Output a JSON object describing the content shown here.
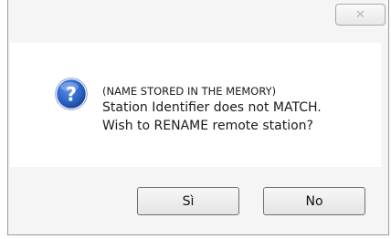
{
  "titlebar": {
    "close_glyph": "✕"
  },
  "dialog": {
    "icon": "question-icon",
    "line1": "(NAME STORED IN THE MEMORY)",
    "line2": "Station Identifier does not MATCH.",
    "line3": "Wish to RENAME remote station?"
  },
  "buttons": {
    "yes_label": "Sì",
    "no_label": "No"
  },
  "colors": {
    "icon_blue": "#2a64c8",
    "content_bg": "#ffffff",
    "footer_bg": "#f0f0f0"
  }
}
